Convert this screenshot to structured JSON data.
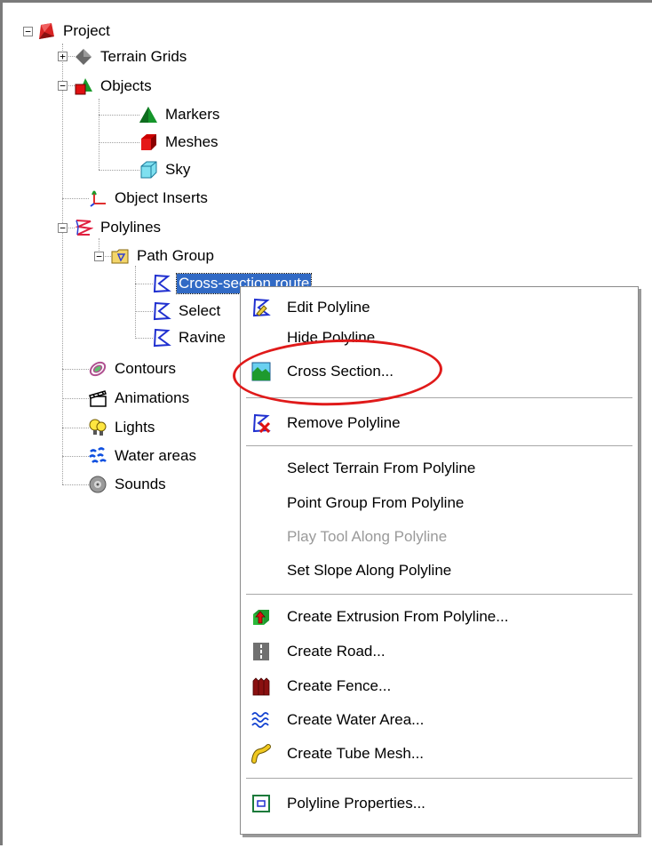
{
  "tree": {
    "root": {
      "label": "Project",
      "icon": "project-icon"
    },
    "items": [
      {
        "label": "Terrain Grids",
        "icon": "terrain-grids-icon"
      },
      {
        "label": "Objects",
        "icon": "objects-icon"
      },
      {
        "label": "Markers",
        "icon": "marker-icon"
      },
      {
        "label": "Meshes",
        "icon": "mesh-icon"
      },
      {
        "label": "Sky",
        "icon": "sky-icon"
      },
      {
        "label": "Object Inserts",
        "icon": "object-inserts-icon"
      },
      {
        "label": "Polylines",
        "icon": "polylines-icon"
      },
      {
        "label": "Path Group",
        "icon": "folder-icon"
      },
      {
        "label": "Cross-section route",
        "icon": "polyline-icon",
        "selected": true
      },
      {
        "label": "Select",
        "icon": "polyline-icon"
      },
      {
        "label": "Ravine",
        "icon": "polyline-icon"
      },
      {
        "label": "Contours",
        "icon": "contours-icon"
      },
      {
        "label": "Animations",
        "icon": "animations-icon"
      },
      {
        "label": "Lights",
        "icon": "lights-icon"
      },
      {
        "label": "Water areas",
        "icon": "water-areas-icon"
      },
      {
        "label": "Sounds",
        "icon": "sounds-icon"
      }
    ]
  },
  "context_menu": {
    "items": [
      {
        "label": "Edit Polyline",
        "icon": "edit-polyline-icon",
        "disabled": false
      },
      {
        "label": "Hide Polyline",
        "icon": "",
        "disabled": false
      },
      {
        "label": "Cross Section...",
        "icon": "cross-section-icon",
        "disabled": false
      },
      {
        "label": "Remove Polyline",
        "icon": "remove-polyline-icon",
        "disabled": false
      },
      {
        "label": "Select Terrain From Polyline",
        "icon": "",
        "disabled": false
      },
      {
        "label": "Point Group From Polyline",
        "icon": "",
        "disabled": false
      },
      {
        "label": "Play Tool Along Polyline",
        "icon": "",
        "disabled": true
      },
      {
        "label": "Set Slope Along Polyline",
        "icon": "",
        "disabled": false
      },
      {
        "label": "Create Extrusion From Polyline...",
        "icon": "extrusion-icon",
        "disabled": false
      },
      {
        "label": "Create Road...",
        "icon": "road-icon",
        "disabled": false
      },
      {
        "label": "Create Fence...",
        "icon": "fence-icon",
        "disabled": false
      },
      {
        "label": "Create Water Area...",
        "icon": "water-area-icon",
        "disabled": false
      },
      {
        "label": "Create Tube Mesh...",
        "icon": "tube-mesh-icon",
        "disabled": false
      },
      {
        "label": "Polyline Properties...",
        "icon": "properties-icon",
        "disabled": false
      }
    ]
  },
  "colors": {
    "selection": "#316ac5",
    "annotation_ring": "#e01a1a",
    "disabled_text": "#9a9a9a"
  }
}
